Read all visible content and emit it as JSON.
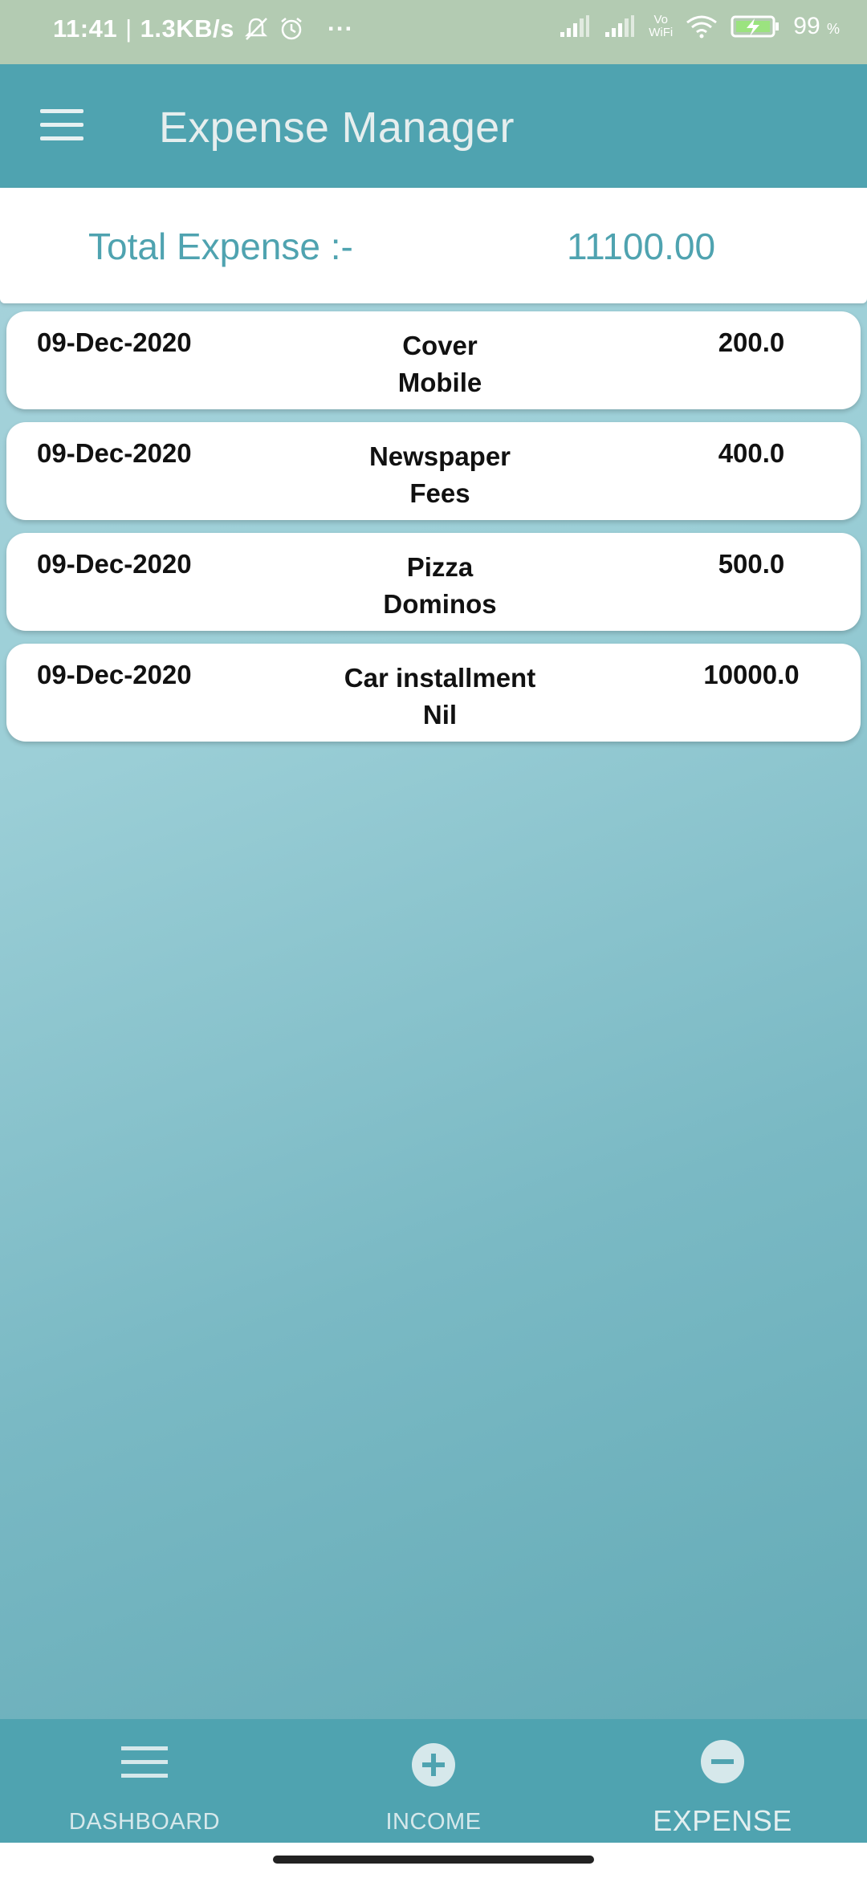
{
  "status_bar": {
    "time": "11:41",
    "net_speed": "1.3KB/s",
    "more": "···",
    "vo_wifi_top": "Vo",
    "vo_wifi_bottom": "WiFi",
    "battery_percent": "99",
    "battery_unit": "%"
  },
  "app_bar": {
    "title": "Expense Manager"
  },
  "summary": {
    "label": "Total Expense :-",
    "value": "11100.00"
  },
  "expenses": [
    {
      "date": "09-Dec-2020",
      "category": "Cover",
      "note": "Mobile",
      "amount": "200.0"
    },
    {
      "date": "09-Dec-2020",
      "category": "Newspaper",
      "note": "Fees",
      "amount": "400.0"
    },
    {
      "date": "09-Dec-2020",
      "category": "Pizza",
      "note": "Dominos",
      "amount": "500.0"
    },
    {
      "date": "09-Dec-2020",
      "category": "Car installment",
      "note": "Nil",
      "amount": "10000.0"
    }
  ],
  "bottom_nav": {
    "dashboard": "DASHBOARD",
    "income": "INCOME",
    "expense": "EXPENSE"
  },
  "colors": {
    "primary": "#4fa3b0",
    "status_bar": "#b3cbb2",
    "card": "#ffffff",
    "text_dark": "#111111"
  }
}
